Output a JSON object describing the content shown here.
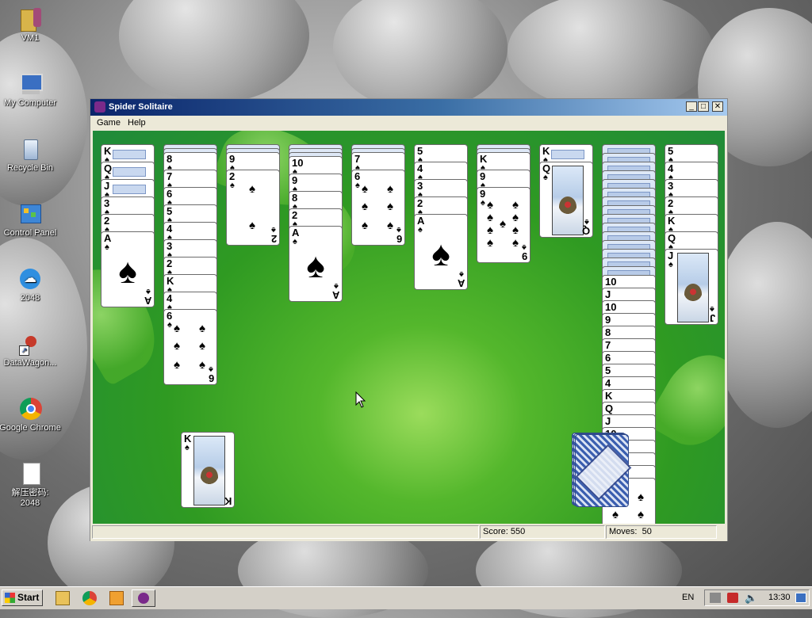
{
  "desktop": {
    "icons": [
      {
        "label": "VM1",
        "icon": "folder-icon"
      },
      {
        "label": "My Computer",
        "icon": "computer-icon"
      },
      {
        "label": "Recycle Bin",
        "icon": "recycle-bin-icon"
      },
      {
        "label": "Control Panel",
        "icon": "control-panel-icon"
      },
      {
        "label": "2048",
        "icon": "cloud-icon"
      },
      {
        "label": "DataWagon...",
        "icon": "shortcut-icon"
      },
      {
        "label": "Google Chrome",
        "icon": "chrome-icon"
      },
      {
        "label": "解压密码:",
        "label2": "2048",
        "icon": "document-icon"
      }
    ]
  },
  "window": {
    "title": "Spider Solitaire",
    "controls": {
      "minimize": "_",
      "maximize": "□",
      "close": "✕"
    },
    "menu": [
      "Game",
      "Help"
    ]
  },
  "suit": "♠",
  "tableau": [
    {
      "down_ranks": [
        "K",
        "Q",
        "J"
      ],
      "up": [
        "3",
        "2",
        "A"
      ]
    },
    {
      "down_ranks": [
        "",
        ""
      ],
      "up": [
        "8",
        "7",
        "6",
        "5",
        "4",
        "3",
        "2",
        "K",
        "4",
        "6"
      ]
    },
    {
      "down_ranks": [
        "",
        ""
      ],
      "up": [
        "9",
        "2"
      ]
    },
    {
      "down_ranks": [
        "",
        "",
        ""
      ],
      "up": [
        "10",
        "9",
        "8",
        "2",
        "A"
      ]
    },
    {
      "down_ranks": [
        "",
        ""
      ],
      "up": [
        "7",
        "6"
      ]
    },
    {
      "down_ranks": [],
      "up": [
        "5",
        "4",
        "3",
        "2",
        "A"
      ]
    },
    {
      "down_ranks": [
        "",
        ""
      ],
      "up": [
        "K",
        "9",
        "9"
      ]
    },
    {
      "down_ranks": [
        "K"
      ],
      "up": [
        "Q"
      ]
    },
    {
      "down_ranks": [
        "",
        "",
        "",
        "",
        "",
        "",
        "",
        "",
        "",
        "",
        "",
        "",
        "",
        "",
        ""
      ],
      "up": [
        "10",
        "J",
        "10",
        "9",
        "8",
        "7",
        "6",
        "5",
        "4",
        "K",
        "Q",
        "J",
        "10",
        "9",
        "8",
        "7",
        "6"
      ]
    },
    {
      "down_ranks": [],
      "up": [
        "5",
        "4",
        "3",
        "2",
        "K",
        "Q",
        "J"
      ]
    }
  ],
  "completed_pile": {
    "top_rank": "K"
  },
  "stock": {
    "deals_remaining": 3
  },
  "status": {
    "score_label": "Score:",
    "score": "550",
    "moves_label": "Moves:",
    "moves": "50"
  },
  "taskbar": {
    "start_label": "Start",
    "quick_launch": [
      "explorer-icon",
      "chrome-icon",
      "media-player-icon",
      "spider-solitaire-icon"
    ],
    "language": "EN",
    "clock": "13:30"
  },
  "colors": {
    "felt": "#2f9a22",
    "titlebar": "#0a246a"
  }
}
